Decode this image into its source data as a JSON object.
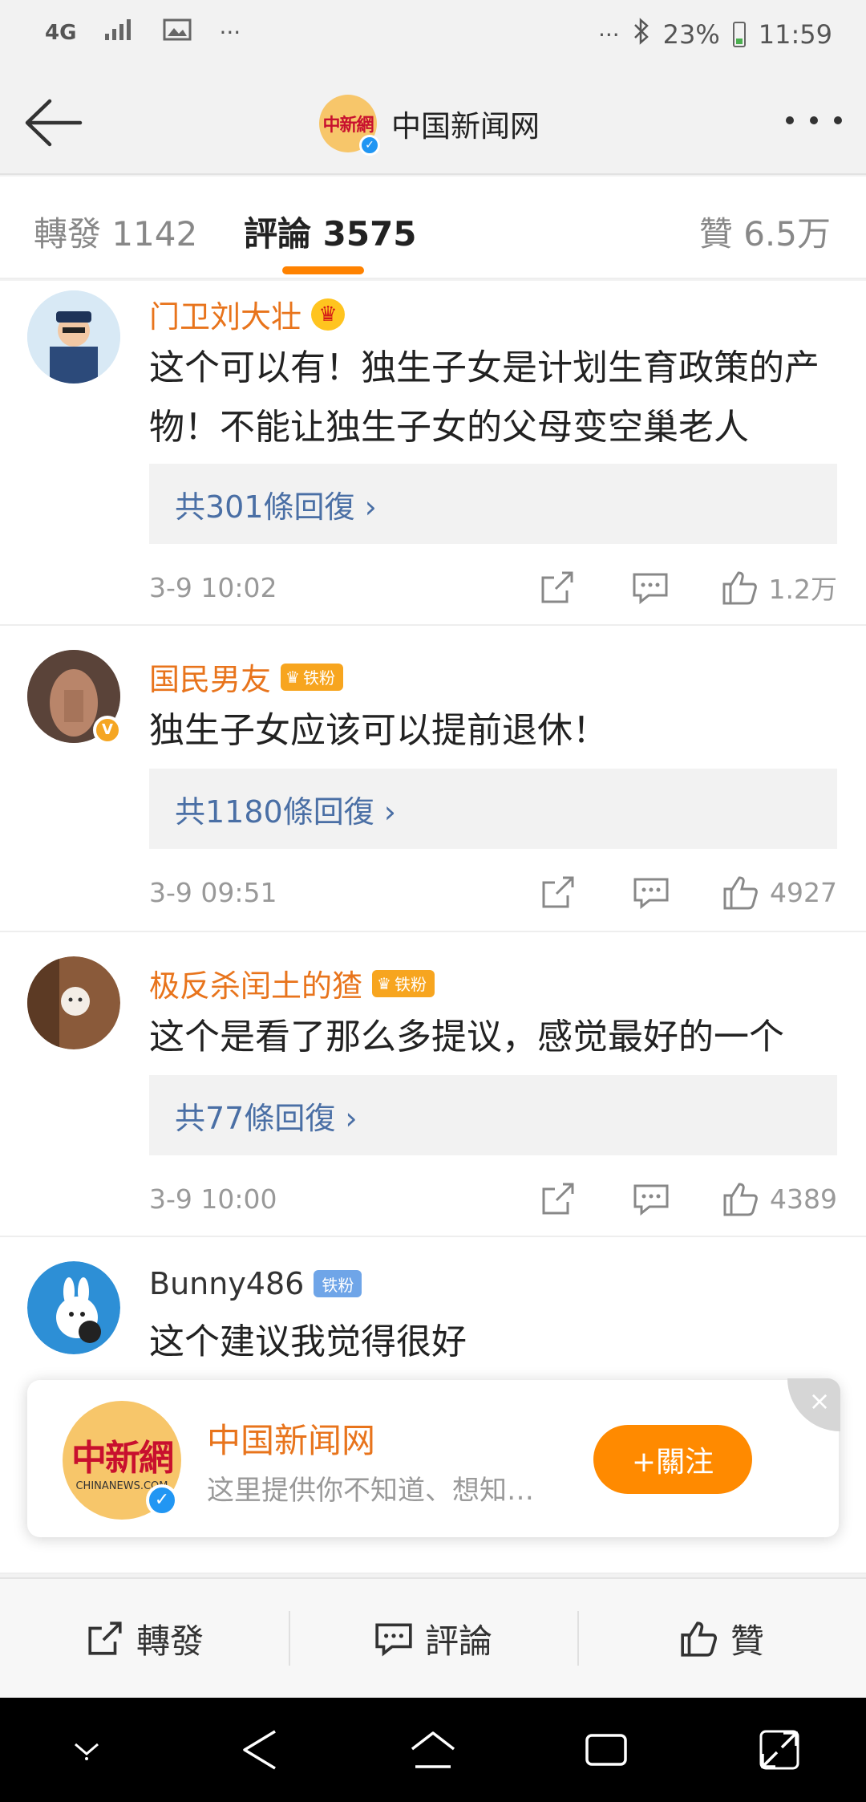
{
  "statusbar": {
    "network": "4G",
    "battery_pct": "23%",
    "time": "11:59"
  },
  "header": {
    "title": "中国新闻网",
    "avatar_logo": "中新網"
  },
  "tabs": {
    "repost": "轉發 1142",
    "comments": "評論 3575",
    "likes": "贊 6.5万"
  },
  "comments": [
    {
      "name": "门卫刘大壮",
      "badge": "",
      "text": "这个可以有！独生子女是计划生育政策的产物！不能让独生子女的父母变空巢老人",
      "replies": "共301條回復 ›",
      "time": "3-9 10:02",
      "likes": "1.2万"
    },
    {
      "name": "国民男友",
      "badge": "铁粉",
      "text": "独生子女应该可以提前退休！",
      "replies": "共1180條回復 ›",
      "time": "3-9 09:51",
      "likes": "4927"
    },
    {
      "name": "极反杀闰土的猹",
      "badge": "铁粉",
      "text": "这个是看了那么多提议，感觉最好的一个",
      "replies": "共77條回復 ›",
      "time": "3-9 10:00",
      "likes": "4389"
    },
    {
      "name": "Bunny486",
      "badge": "铁粉",
      "text": "这个建议我觉得很好",
      "replies": "",
      "time": "",
      "likes": ""
    }
  ],
  "follow_card": {
    "name": "中国新闻网",
    "desc": "这里提供你不知道、想知道的新闻资讯…",
    "follow_label": "+關注",
    "logo": "中新網",
    "logo_sub": "CHINANEWS.COM",
    "close": "×"
  },
  "bottombar": {
    "repost": "轉發",
    "comment": "評論",
    "like": "贊"
  },
  "colors": {
    "accent": "#ff8200",
    "name": "#e8741c",
    "link": "#4a6fa5"
  }
}
